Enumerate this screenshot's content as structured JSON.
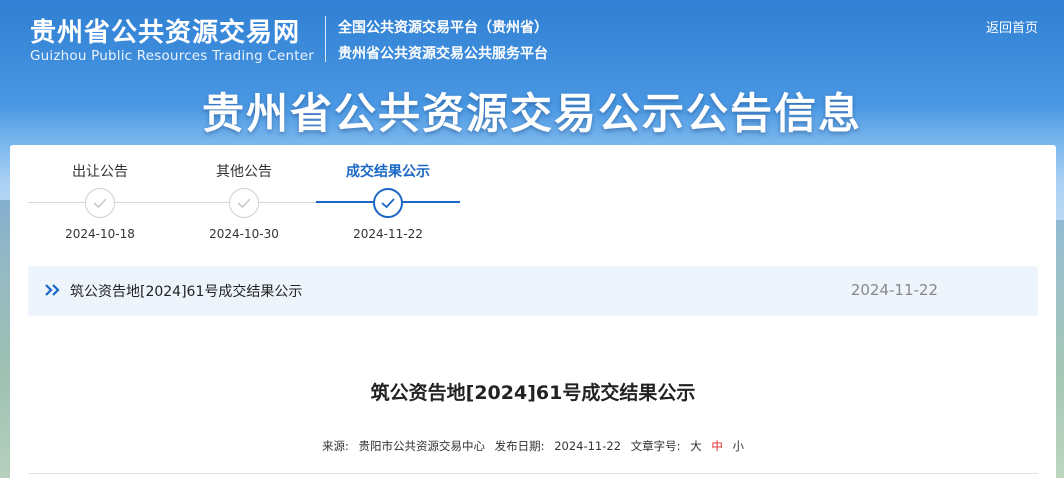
{
  "header": {
    "logo_cn": "贵州省公共资源交易网",
    "logo_en": "Guizhou Public Resources Trading Center",
    "platform_line1": "全国公共资源交易平台（贵州省）",
    "platform_line2": "贵州省公共资源交易公共服务平台",
    "back_home": "返回首页"
  },
  "banner": {
    "title": "贵州省公共资源交易公示公告信息"
  },
  "steps": [
    {
      "label": "出让公告",
      "date": "2024-10-18",
      "active": false,
      "icon": "check-icon"
    },
    {
      "label": "其他公告",
      "date": "2024-10-30",
      "active": false,
      "icon": "check-icon"
    },
    {
      "label": "成交结果公示",
      "date": "2024-11-22",
      "active": true,
      "icon": "check-icon"
    }
  ],
  "notice": {
    "title": "筑公资告地[2024]61号成交结果公示",
    "date": "2024-11-22",
    "icon": "double-chevron-right-icon"
  },
  "article": {
    "title": "筑公资告地[2024]61号成交结果公示",
    "source_label": "来源:",
    "source_value": "贵阳市公共资源交易中心",
    "publish_label": "发布日期:",
    "publish_value": "2024-11-22",
    "font_size_label": "文章字号:",
    "sizes": [
      "大",
      "中",
      "小"
    ],
    "current_size": "中"
  },
  "colors": {
    "accent": "#1a67c5",
    "current_size": "#e02a2a"
  }
}
